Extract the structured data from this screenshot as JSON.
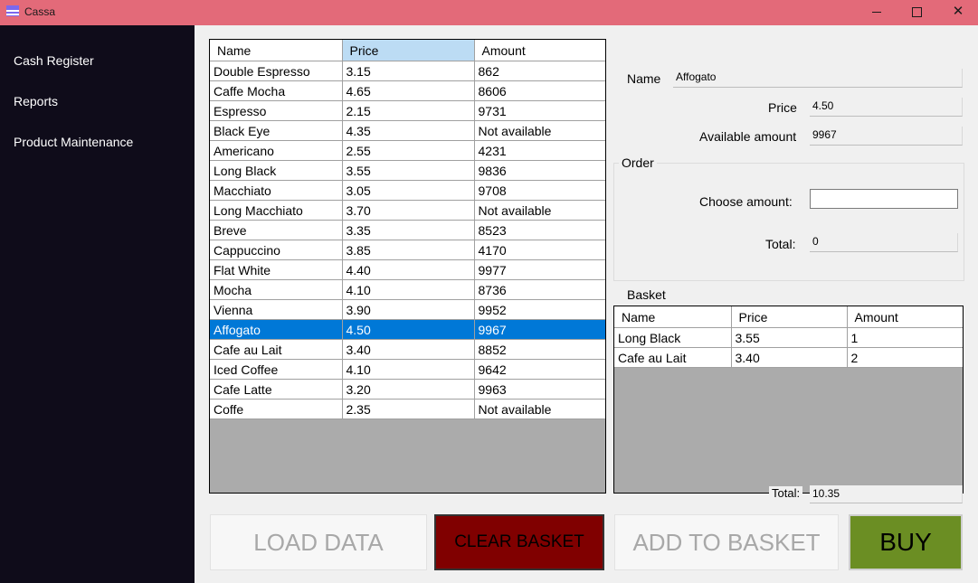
{
  "window": {
    "title": "Cassa",
    "minimize": "—",
    "maximize": "☐",
    "close": "✕"
  },
  "sidebar": {
    "items": [
      {
        "label": "Cash Register"
      },
      {
        "label": "Reports"
      },
      {
        "label": "Product Maintenance"
      }
    ]
  },
  "products": {
    "columns": [
      "Name",
      "Price",
      "Amount"
    ],
    "rows": [
      [
        "Double Espresso",
        "3.15",
        "862"
      ],
      [
        "Caffe Mocha",
        "4.65",
        "8606"
      ],
      [
        "Espresso",
        "2.15",
        "9731"
      ],
      [
        "Black Eye",
        "4.35",
        "Not available"
      ],
      [
        "Americano",
        "2.55",
        "4231"
      ],
      [
        "Long Black",
        "3.55",
        "9836"
      ],
      [
        "Macchiato",
        "3.05",
        "9708"
      ],
      [
        "Long Macchiato",
        "3.70",
        "Not available"
      ],
      [
        "Breve",
        "3.35",
        "8523"
      ],
      [
        "Cappuccino",
        "3.85",
        "4170"
      ],
      [
        "Flat White",
        "4.40",
        "9977"
      ],
      [
        "Mocha",
        "4.10",
        "8736"
      ],
      [
        "Vienna",
        "3.90",
        "9952"
      ],
      [
        "Affogato",
        "4.50",
        "9967"
      ],
      [
        "Cafe au Lait",
        "3.40",
        "8852"
      ],
      [
        "Iced Coffee",
        "4.10",
        "9642"
      ],
      [
        "Cafe Latte",
        "3.20",
        "9963"
      ],
      [
        "Coffe",
        "2.35",
        "Not available"
      ]
    ],
    "selected_row": "Affogato",
    "sorted_column": "Price"
  },
  "details": {
    "name_label": "Name",
    "name_value": "Affogato",
    "price_label": "Price",
    "price_value": "4.50",
    "available_label": "Available amount",
    "available_value": "9967"
  },
  "order": {
    "title": "Order",
    "choose_label": "Choose amount:",
    "choose_value": "",
    "total_label": "Total:",
    "total_value": "0"
  },
  "basket": {
    "title": "Basket",
    "columns": [
      "Name",
      "Price",
      "Amount"
    ],
    "rows": [
      [
        "Long Black",
        "3.55",
        "1"
      ],
      [
        "Cafe au Lait",
        "3.40",
        "2"
      ]
    ],
    "total_label": "Total:",
    "total_value": "10.35"
  },
  "buttons": {
    "load": "LOAD DATA",
    "clear": "CLEAR BASKET",
    "add": "ADD TO BASKET",
    "buy": "BUY"
  },
  "colors": {
    "titlebar": "#e36a79",
    "sidebar": "#0f0c1a",
    "selection": "#0078d7",
    "clear_button": "#800000",
    "buy_button": "#6b8e23"
  }
}
